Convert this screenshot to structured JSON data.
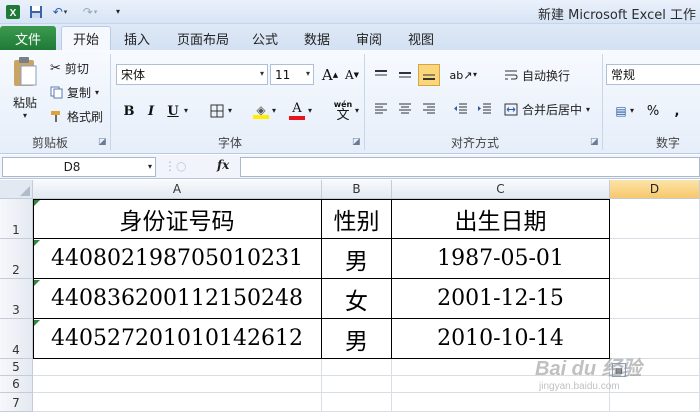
{
  "app": {
    "title": "新建 Microsoft Excel 工作",
    "colors": {
      "file_tab": "#1f7a37",
      "accent": "#fbd77b",
      "excel_logo": "#1e7a37"
    }
  },
  "qat": {
    "excel_icon": "excel-logo-icon",
    "save_icon": "save-icon",
    "undo_icon": "undo-icon",
    "redo_icon": "redo-icon",
    "customize_icon": "chevron-down-icon"
  },
  "tabs": {
    "file": "文件",
    "home": "开始",
    "insert": "插入",
    "layout": "页面布局",
    "formulas": "公式",
    "data": "数据",
    "review": "审阅",
    "view": "视图"
  },
  "ribbon": {
    "clipboard": {
      "paste": "粘贴",
      "cut": "剪切",
      "copy": "复制",
      "format_painter": "格式刷",
      "label": "剪贴板"
    },
    "font": {
      "name": "宋体",
      "size": "11",
      "grow": "A",
      "shrink": "A",
      "bold": "B",
      "italic": "I",
      "underline": "U",
      "font_color": "A",
      "wen": "wén",
      "wen_char": "文",
      "label": "字体"
    },
    "alignment": {
      "wrap": "自动换行",
      "merge": "合并后居中",
      "label": "对齐方式"
    },
    "number": {
      "format": "常规",
      "percent": "%",
      "label": "数字"
    }
  },
  "formula_bar": {
    "name_box": "D8",
    "fx": "fx",
    "value": ""
  },
  "sheet": {
    "columns": [
      "A",
      "B",
      "C",
      "D"
    ],
    "rows": [
      "1",
      "2",
      "3",
      "4",
      "5",
      "6",
      "7"
    ],
    "header": [
      "身份证号码",
      "性别",
      "出生日期"
    ],
    "records": [
      [
        "440802198705010231",
        "男",
        "1987-05-01"
      ],
      [
        "440836200112150248",
        "女",
        "2001-12-15"
      ],
      [
        "440527201010142612",
        "男",
        "2010-10-14"
      ]
    ],
    "watermark": "Bai du 经验",
    "watermark_url": "jingyan.baidu.com"
  }
}
